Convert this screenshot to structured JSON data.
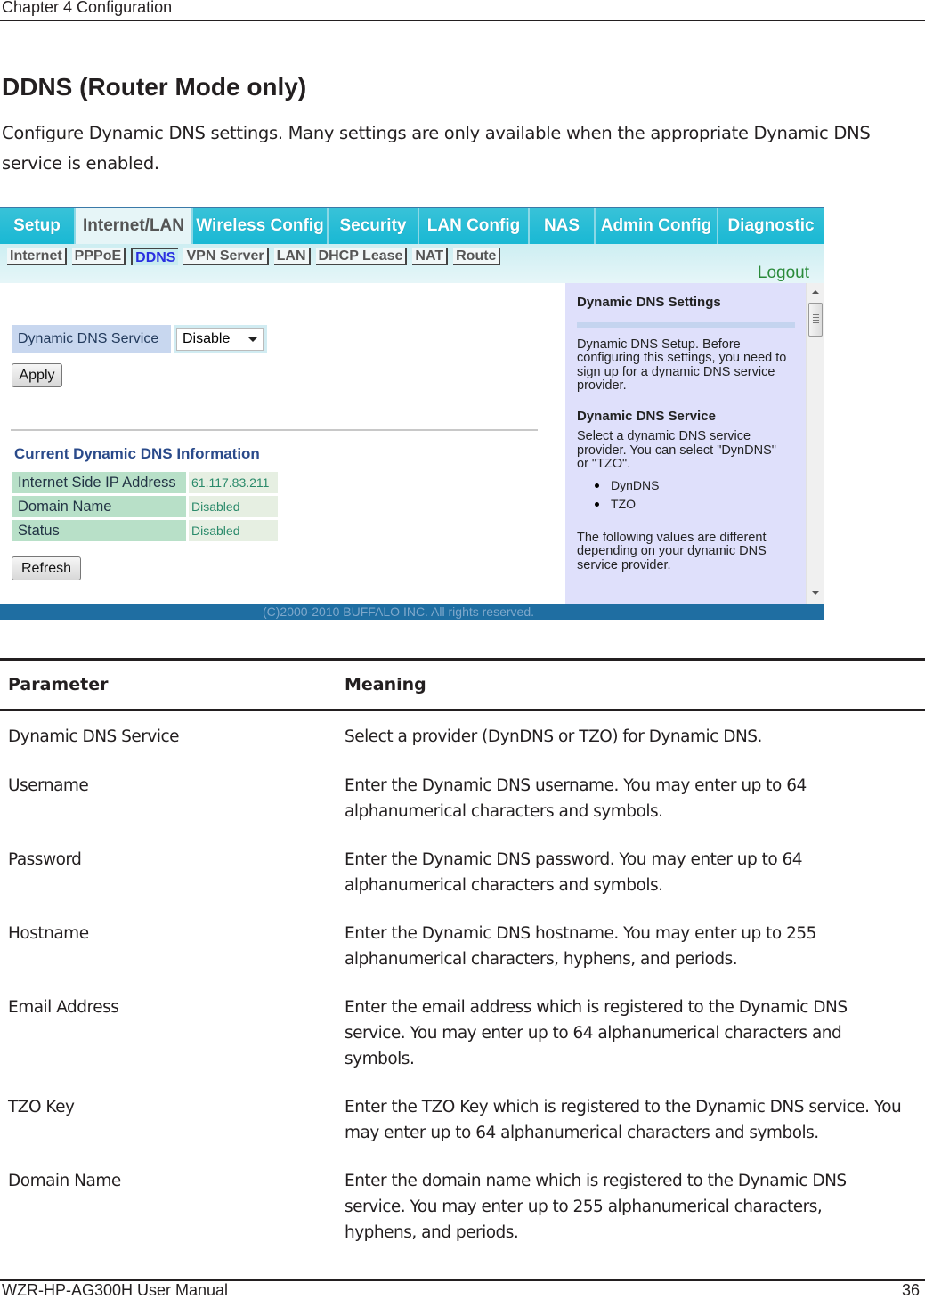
{
  "header": {
    "chapter": "Chapter 4  Configuration"
  },
  "section": {
    "title": "DDNS (Router Mode only)",
    "intro": "Configure Dynamic DNS settings.  Many settings are only available when the appropriate Dynamic DNS service is enabled."
  },
  "router_ui": {
    "tabs": [
      {
        "label": "Setup",
        "active": false
      },
      {
        "label": "Internet/LAN",
        "active": true
      },
      {
        "label": "Wireless Config",
        "active": false
      },
      {
        "label": "Security",
        "active": false
      },
      {
        "label": "LAN Config",
        "active": false
      },
      {
        "label": "NAS",
        "active": false
      },
      {
        "label": "Admin Config",
        "active": false
      },
      {
        "label": "Diagnostic",
        "active": false
      }
    ],
    "subtabs": [
      {
        "label": "Internet",
        "active": false
      },
      {
        "label": "PPPoE",
        "active": false
      },
      {
        "label": "DDNS",
        "active": true
      },
      {
        "label": "VPN Server",
        "active": false
      },
      {
        "label": "LAN",
        "active": false
      },
      {
        "label": "DHCP Lease",
        "active": false
      },
      {
        "label": "NAT",
        "active": false
      },
      {
        "label": "Route",
        "active": false
      }
    ],
    "logout": "Logout",
    "ddns_service_label": "Dynamic DNS Service",
    "ddns_service_value": "Disable",
    "apply_button": "Apply",
    "info_title": "Current Dynamic DNS Information",
    "info_rows": [
      {
        "label": "Internet Side IP Address",
        "value": "61.117.83.211"
      },
      {
        "label": "Domain Name",
        "value": "Disabled"
      },
      {
        "label": "Status",
        "value": "Disabled"
      }
    ],
    "refresh_button": "Refresh",
    "help": {
      "heading": "Dynamic DNS Settings",
      "setup_text": "Dynamic DNS Setup. Before configuring this settings, you need to sign up for a dynamic DNS service provider.",
      "service_heading": "Dynamic DNS Service",
      "service_text": "Select a dynamic DNS service provider. You can select \"DynDNS\" or \"TZO\".",
      "providers": [
        "DynDNS",
        "TZO"
      ],
      "note": "The following values are different depending on your dynamic DNS service provider."
    },
    "copyright": "(C)2000-2010 BUFFALO INC. All rights reserved.",
    "colors": {
      "tab_bar": "#19b8d4",
      "active_subtab_text": "#2a30e0",
      "logout": "#2a8a3a",
      "help_bg": "#dfe0fb",
      "footer_bar": "#1f6ea2"
    }
  },
  "param_table": {
    "headers": {
      "parameter": "Parameter",
      "meaning": "Meaning"
    },
    "rows": [
      {
        "parameter": "Dynamic DNS Service",
        "meaning": "Select a provider (DynDNS or TZO) for Dynamic DNS."
      },
      {
        "parameter": "Username",
        "meaning": "Enter the Dynamic DNS username. You may enter up to 64 alphanumerical characters and symbols."
      },
      {
        "parameter": "Password",
        "meaning": "Enter the Dynamic DNS password. You may enter up to 64 alphanumerical characters and symbols."
      },
      {
        "parameter": "Hostname",
        "meaning": "Enter the Dynamic DNS hostname. You may enter up to 255 alphanumerical characters, hyphens, and periods."
      },
      {
        "parameter": "Email Address",
        "meaning": "Enter the email address which is registered to the Dynamic DNS service. You may enter up to 64 alphanumerical characters and symbols."
      },
      {
        "parameter": "TZO Key",
        "meaning": "Enter the TZO Key which is registered to the Dynamic DNS service. You may enter up to 64 alphanumerical characters and symbols."
      },
      {
        "parameter": "Domain Name",
        "meaning": "Enter the domain name which is registered to the Dynamic DNS service.  You may enter up to 255 alphanumerical characters, hyphens, and periods."
      }
    ]
  },
  "footer": {
    "manual": "WZR-HP-AG300H User Manual",
    "page": "36"
  }
}
